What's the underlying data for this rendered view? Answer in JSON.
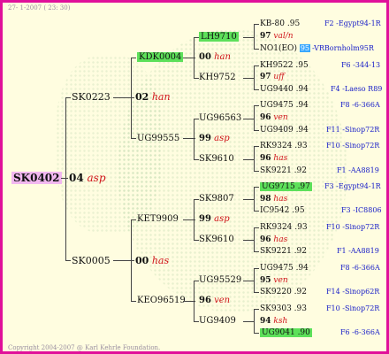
{
  "header": "27- 1-2007 ( 23: 30)",
  "footer": "Copyright 2004-2007 @ Karl Kehrle Foundation.",
  "root": {
    "id": "SK0402",
    "year": "04",
    "origin": "asp"
  },
  "gen1": [
    {
      "id": "SK0223",
      "year": "02",
      "origin": "han"
    },
    {
      "id": "SK0005",
      "year": "00",
      "origin": "has"
    }
  ],
  "gen2": [
    {
      "id": "KDK0004",
      "year": "00",
      "origin": "han"
    },
    {
      "id": "UG99555",
      "year": "99",
      "origin": "asp"
    },
    {
      "id": "KET9909",
      "year": "99",
      "origin": "asp"
    },
    {
      "id": "KEO96519",
      "year": "96",
      "origin": "ven"
    }
  ],
  "gen3": [
    {
      "id": "LH9710",
      "year": "97",
      "origin": "val/n"
    },
    {
      "id": "KH9752",
      "year": "97",
      "origin": "uff"
    },
    {
      "id": "UG96563",
      "year": "96",
      "origin": "ven"
    },
    {
      "id": "SK9610",
      "year": "96",
      "origin": "has"
    },
    {
      "id": "SK9807",
      "year": "98",
      "origin": "has"
    },
    {
      "id": "SK9610",
      "year": "96",
      "origin": "has"
    },
    {
      "id": "UG95529",
      "year": "95",
      "origin": "ven"
    },
    {
      "id": "UG9409",
      "year": "94",
      "origin": "ksh"
    }
  ],
  "gen4": [
    {
      "id": "KB-80",
      "year": ".95",
      "loc": "F2 -Egypt94-1R"
    },
    {
      "id": "NO1(EO)",
      "year": "95",
      "loc": "-VRBornholm95R"
    },
    {
      "id": "KH9522",
      "year": ".95",
      "loc": "F6 -344-13"
    },
    {
      "id": "UG9440",
      "year": ".94",
      "loc": "F4 -Laeso R89"
    },
    {
      "id": "UG9475",
      "year": ".94",
      "loc": "F8 -6-366A"
    },
    {
      "id": "UG9409",
      "year": ".94",
      "loc": "F11 -Sinop72R"
    },
    {
      "id": "RK9324",
      "year": ".93",
      "loc": "F10 -Sinop72R"
    },
    {
      "id": "SK9221",
      "year": ".92",
      "loc": "F1 -AA8819"
    },
    {
      "id": "UG9715",
      "year": ".97",
      "loc": "F3 -Egypt94-1R"
    },
    {
      "id": "IC9542",
      "year": ".95",
      "loc": "F3 -IC8806"
    },
    {
      "id": "RK9324",
      "year": ".93",
      "loc": "F10 -Sinop72R"
    },
    {
      "id": "SK9221",
      "year": ".92",
      "loc": "F1 -AA8819"
    },
    {
      "id": "UG9475",
      "year": ".94",
      "loc": "F8 -6-366A"
    },
    {
      "id": "SK9220",
      "year": ".92",
      "loc": "F14 -Sinop62R"
    },
    {
      "id": "SK9303",
      "year": ".93",
      "loc": "F10 -Sinop72R"
    },
    {
      "id": "UG9041",
      "year": ".90",
      "loc": "F6 -6-366A"
    }
  ]
}
